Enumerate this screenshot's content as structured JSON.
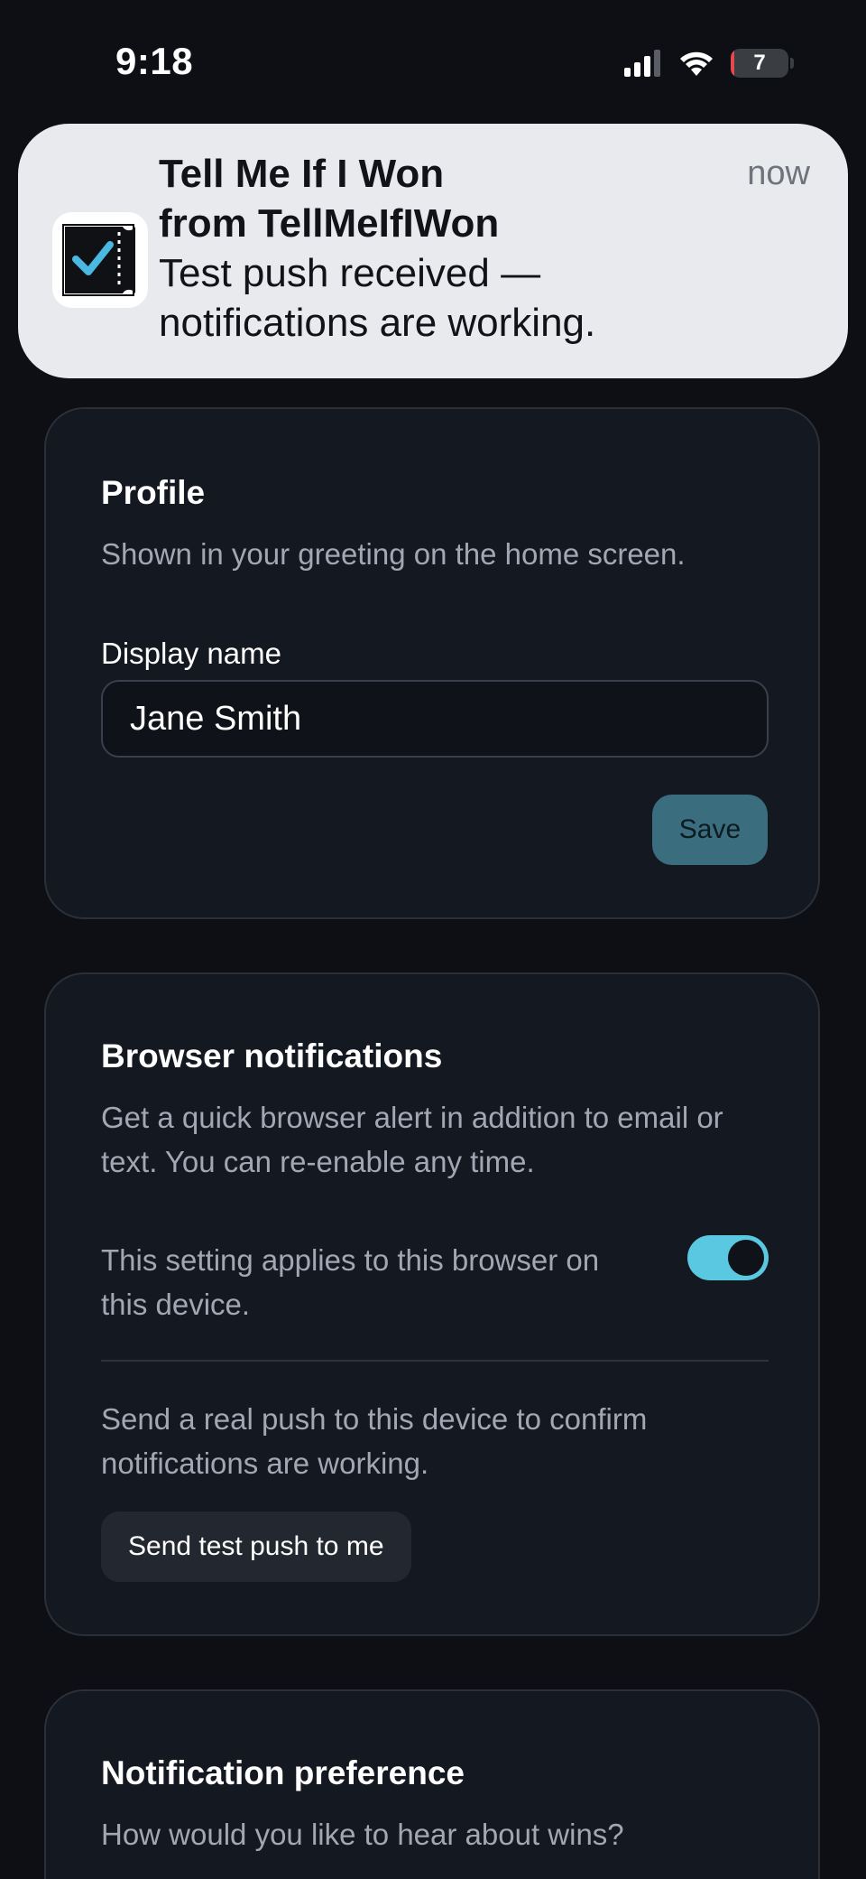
{
  "status_bar": {
    "time": "9:18",
    "battery_level": "7",
    "battery_fraction": 0.07,
    "battery_color": "#e5484d",
    "icons": [
      "cellular-signal-icon",
      "wifi-icon",
      "battery-icon"
    ]
  },
  "notification_banner": {
    "app_icon": "ticket-check-icon",
    "title_line1": "Tell Me If I Won",
    "title_line2": "from TellMeIfIWon",
    "body_line1": "Test push received —",
    "body_line2": "notifications are working.",
    "time": "now"
  },
  "profile": {
    "title": "Profile",
    "description": "Shown in your greeting on the home screen.",
    "display_name_label": "Display name",
    "display_name_value": "Jane Smith",
    "save_label": "Save"
  },
  "browser_notifications": {
    "title": "Browser notifications",
    "description": "Get a quick browser alert in addition to email or text. You can re-enable any time.",
    "setting_text": "This setting applies to this browser on this device.",
    "toggle_enabled": true,
    "test_description": "Send a real push to this device to confirm notifications are working.",
    "test_button_label": "Send test push to me"
  },
  "notification_preference": {
    "title": "Notification preference",
    "description": "How would you like to hear about wins?"
  },
  "colors": {
    "background": "#0d0f14",
    "card": "#141820",
    "accent": "#5ac8e0",
    "save_button": "#3a6d7e",
    "banner": "#e8eaed"
  }
}
